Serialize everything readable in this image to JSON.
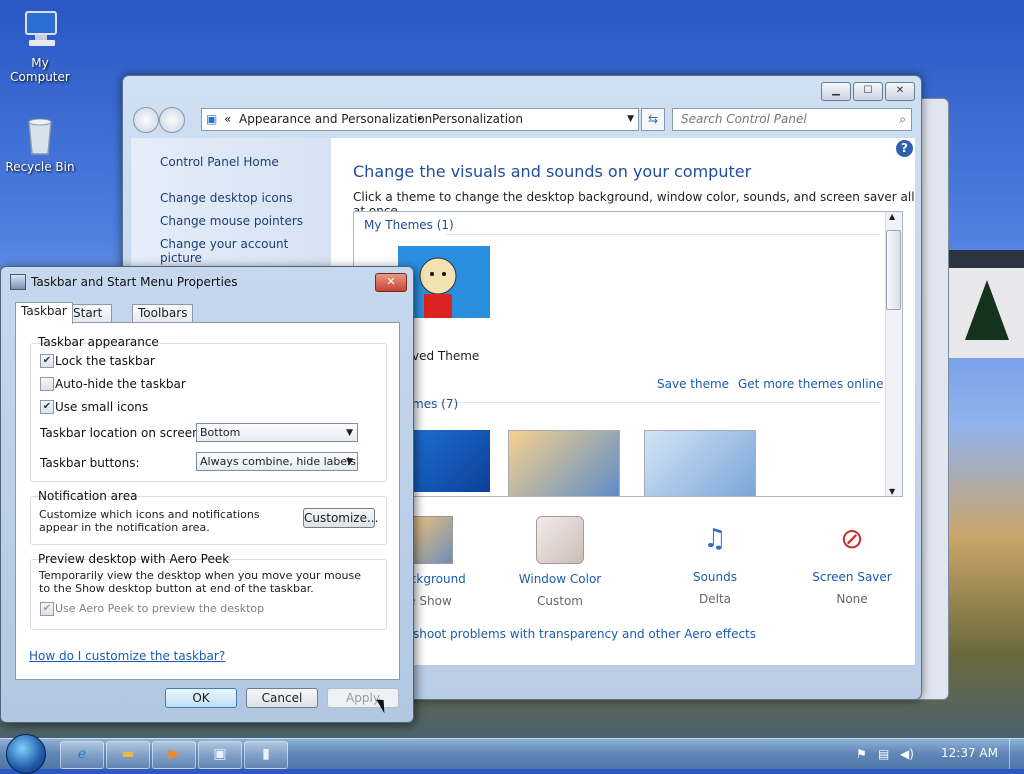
{
  "desktop": {
    "icons": [
      {
        "label": "My Computer",
        "icon": "computer-icon"
      },
      {
        "label": "Recycle Bin",
        "icon": "recycle-bin-icon"
      }
    ]
  },
  "control_panel": {
    "window_buttons": {
      "minimize": "▁",
      "maximize": "☐",
      "close": "✕"
    },
    "breadcrumb": {
      "prefix": "«",
      "crumbs": [
        "Appearance and Personalization",
        "Personalization"
      ],
      "separator": "▸"
    },
    "search_placeholder": "Search Control Panel",
    "left_links": [
      "Control Panel Home",
      "Change desktop icons",
      "Change mouse pointers",
      "Change your account picture"
    ],
    "heading": "Change the visuals and sounds on your computer",
    "subtitle": "Click a theme to change the desktop background, window color, sounds, and screen saver all at once.",
    "my_themes_label": "My Themes (1)",
    "unsaved_theme_label": "ved Theme",
    "save_theme": "Save theme",
    "get_more_themes": "Get more themes online",
    "aero_themes_label": "mes (7)",
    "bottom_tiles": [
      {
        "name": "Background",
        "value": "e Show"
      },
      {
        "name": "Window Color",
        "value": "Custom"
      },
      {
        "name": "Sounds",
        "value": "Delta"
      },
      {
        "name": "Screen Saver",
        "value": "None"
      }
    ],
    "troubleshoot_link": "shoot problems with transparency and other Aero effects",
    "help_icon": "?"
  },
  "dialog": {
    "title": "Taskbar and Start Menu Properties",
    "close": "✕",
    "tabs": [
      "Taskbar",
      "Start Menu",
      "Toolbars"
    ],
    "appearance": {
      "label": "Taskbar appearance",
      "lock": {
        "label": "Lock the taskbar",
        "checked": true
      },
      "autohide": {
        "label": "Auto-hide the taskbar",
        "checked": false
      },
      "small_icons": {
        "label": "Use small icons",
        "checked": true
      },
      "location_label": "Taskbar location on screen:",
      "location_value": "Bottom",
      "buttons_label": "Taskbar buttons:",
      "buttons_value": "Always combine, hide labels"
    },
    "notification": {
      "label": "Notification area",
      "text": "Customize which icons and notifications appear in the notification area.",
      "customize": "Customize..."
    },
    "peek": {
      "label": "Preview desktop with Aero Peek",
      "text": "Temporarily view the desktop when you move your mouse to the Show desktop button at end of the taskbar.",
      "checkbox_label": "Use Aero Peek to preview the desktop",
      "checked": true
    },
    "help_link": "How do I customize the taskbar?",
    "ok": "OK",
    "cancel": "Cancel",
    "apply": "Apply"
  },
  "taskbar": {
    "pinned": [
      "internet-explorer-icon",
      "folder-icon",
      "media-player-icon",
      "control-panel-icon",
      "taskbar-properties-icon"
    ],
    "clock": "12:37 AM"
  }
}
